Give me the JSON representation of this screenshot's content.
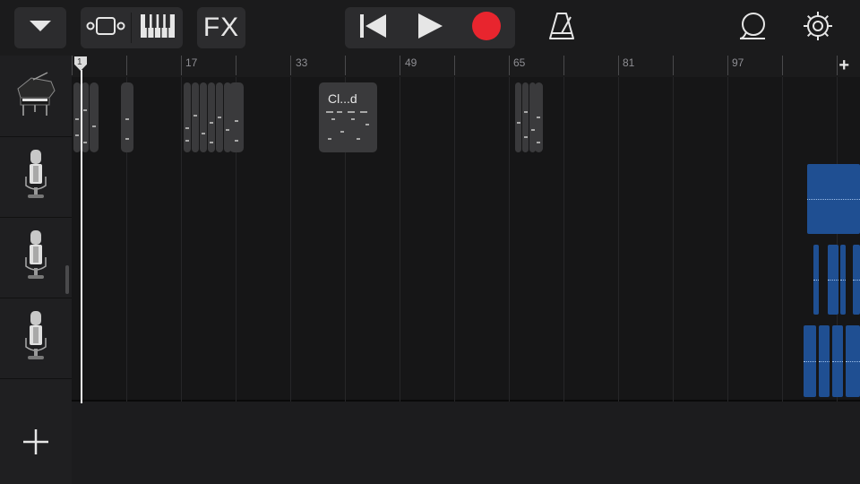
{
  "toolbar": {
    "view_menu_icon": "chevron-down",
    "tracks_view_icon": "tracks-view",
    "keyboard_icon": "keyboard",
    "fx_label": "FX",
    "rewind_icon": "skip-back",
    "play_icon": "play",
    "record_icon": "record",
    "metronome_icon": "metronome",
    "loop_icon": "loop-browser",
    "settings_icon": "gear",
    "record_color": "#e8252e"
  },
  "ruler": {
    "bars": [
      "1",
      "17",
      "33",
      "49",
      "65",
      "81",
      "97"
    ],
    "add_label": "+"
  },
  "tracks": [
    {
      "instrument": "grand-piano"
    },
    {
      "instrument": "microphone"
    },
    {
      "instrument": "microphone"
    },
    {
      "instrument": "microphone"
    }
  ],
  "regions": {
    "midi_region_label": "Cl...d"
  },
  "playhead": {
    "bar": "1"
  },
  "add_track_label": "+",
  "colors": {
    "audio_region": "#1f4f92",
    "midi_region": "#3a3a3c"
  }
}
